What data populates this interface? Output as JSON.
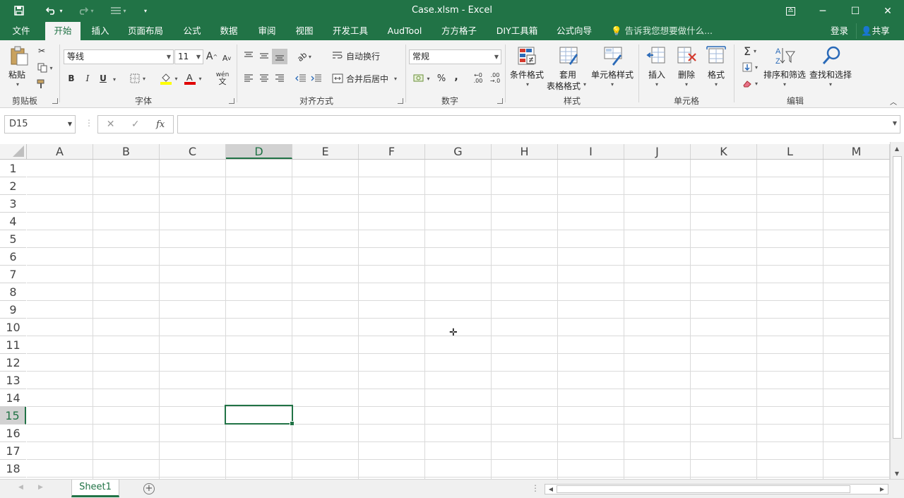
{
  "app": {
    "title": "Case.xlsm - Excel"
  },
  "quick_access": {
    "save": "save-icon",
    "undo": "undo-icon",
    "redo": "redo-icon"
  },
  "window_buttons": {
    "ribbon_display": "ribbon-display-icon",
    "minimize": "─",
    "maximize": "☐",
    "close": "✕"
  },
  "tabs": [
    "文件",
    "开始",
    "插入",
    "页面布局",
    "公式",
    "数据",
    "审阅",
    "视图",
    "开发工具",
    "AudTool",
    "方方格子",
    "DIY工具箱",
    "公式向导"
  ],
  "active_tab": "开始",
  "tell_me": "告诉我您想要做什么...",
  "account": {
    "login": "登录",
    "share": "共享"
  },
  "ribbon": {
    "clipboard": {
      "label": "剪贴板",
      "paste": "粘贴"
    },
    "font": {
      "label": "字体",
      "font_name": "等线",
      "font_size": "11",
      "bold": "B",
      "italic": "I",
      "underline": "U",
      "grow": "A",
      "shrink": "A",
      "wen": "wén"
    },
    "alignment": {
      "label": "对齐方式",
      "wrap_text": "自动换行",
      "merge_center": "合并后居中"
    },
    "number": {
      "label": "数字",
      "format": "常规",
      "percent": "%",
      "comma": ","
    },
    "styles": {
      "label": "样式",
      "conditional": "条件格式",
      "table_format_1": "套用",
      "table_format_2": "表格格式",
      "cell_styles": "单元格样式"
    },
    "cells": {
      "label": "单元格",
      "insert": "插入",
      "delete": "删除",
      "format": "格式"
    },
    "editing": {
      "label": "编辑",
      "sort_filter": "排序和筛选",
      "find_select": "查找和选择",
      "sum": "Σ"
    }
  },
  "formula_bar": {
    "name_box": "D15",
    "cancel": "✕",
    "enter": "✓",
    "fx": "fx",
    "value": ""
  },
  "sheet": {
    "columns": [
      "A",
      "B",
      "C",
      "D",
      "E",
      "F",
      "G",
      "H",
      "I",
      "J",
      "K",
      "L",
      "M"
    ],
    "rows": [
      "1",
      "2",
      "3",
      "4",
      "5",
      "6",
      "7",
      "8",
      "9",
      "10",
      "11",
      "12",
      "13",
      "14",
      "15",
      "16",
      "17",
      "18"
    ],
    "selected_column": "D",
    "selected_row": "15",
    "tabs": [
      "Sheet1"
    ],
    "active_tab": "Sheet1"
  },
  "colors": {
    "accent": "#217346"
  }
}
